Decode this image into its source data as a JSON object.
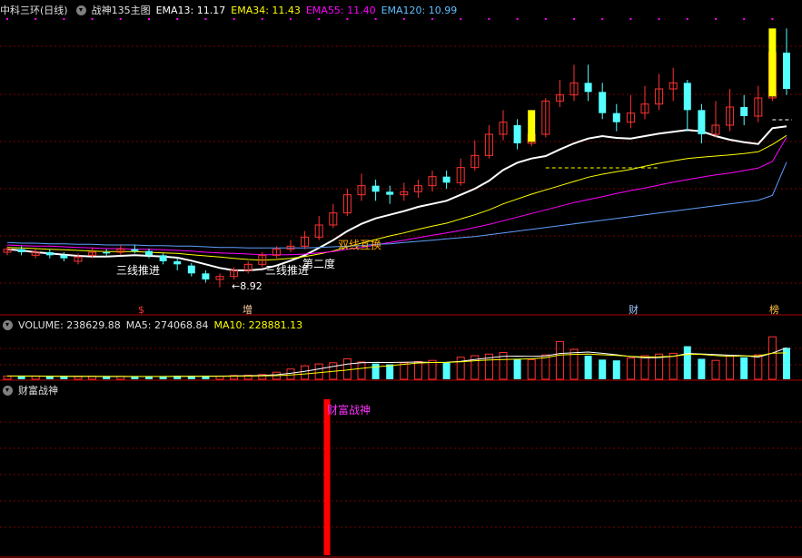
{
  "main_header": {
    "title": "中科三环(日线)",
    "indicator": "战神135主图",
    "ema13": "EMA13: 11.17",
    "ema34": "EMA34: 11.43",
    "ema55": "EMA55: 11.40",
    "ema120": "EMA120: 10.99"
  },
  "volume_header": {
    "volume": "VOLUME: 238629.88",
    "ma5": "MA5: 274068.84",
    "ma10": "MA10: 228881.13"
  },
  "sub_header": {
    "title": "财富战神"
  },
  "annotations": {
    "push1": "三线推进",
    "push2": "三线推进",
    "low_price": "8.92",
    "second_time": "第二度",
    "double_cross": "双线互换",
    "sub_label": "财富战神"
  },
  "event_markers": [
    "$",
    "增",
    "财",
    "榜"
  ],
  "colors": {
    "up": "#ff3232",
    "down": "#54ffff",
    "ema13": "#ffffff",
    "ema34": "#ffff00",
    "ema55": "#ff00ff",
    "ema120": "#5f9fff",
    "signal_bar": "#ffff00",
    "grid": "#7a0000",
    "sub_bar": "#ff0000"
  },
  "chart_data": [
    {
      "type": "candlestick",
      "title": "中科三环(日线)",
      "ylim": [
        8.6,
        13.4
      ],
      "low_marker": 8.92,
      "series": [
        {
          "name": "EMA13",
          "values": [
            9.55,
            9.53,
            9.5,
            9.48,
            9.46,
            9.44,
            9.43,
            9.43,
            9.44,
            9.45,
            9.44,
            9.43,
            9.41,
            9.36,
            9.3,
            9.24,
            9.2,
            9.2,
            9.22,
            9.28,
            9.36,
            9.45,
            9.57,
            9.7,
            9.85,
            9.97,
            10.06,
            10.12,
            10.18,
            10.25,
            10.3,
            10.35,
            10.45,
            10.55,
            10.68,
            10.86,
            10.98,
            11.05,
            11.09,
            11.2,
            11.3,
            11.38,
            11.42,
            11.39,
            11.38,
            11.42,
            11.46,
            11.49,
            11.52,
            11.5,
            11.42,
            11.36,
            11.32,
            11.29,
            11.55,
            11.58
          ]
        },
        {
          "name": "EMA34",
          "values": [
            9.58,
            9.57,
            9.56,
            9.55,
            9.54,
            9.53,
            9.52,
            9.51,
            9.51,
            9.51,
            9.5,
            9.49,
            9.48,
            9.46,
            9.44,
            9.42,
            9.4,
            9.38,
            9.37,
            9.38,
            9.4,
            9.43,
            9.47,
            9.52,
            9.59,
            9.65,
            9.71,
            9.77,
            9.82,
            9.88,
            9.93,
            9.98,
            10.05,
            10.12,
            10.2,
            10.3,
            10.38,
            10.46,
            10.53,
            10.6,
            10.67,
            10.74,
            10.79,
            10.83,
            10.87,
            10.92,
            10.97,
            11.01,
            11.05,
            11.07,
            11.09,
            11.11,
            11.13,
            11.16,
            11.28,
            11.43
          ]
        },
        {
          "name": "EMA55",
          "values": [
            9.62,
            9.61,
            9.6,
            9.6,
            9.59,
            9.58,
            9.57,
            9.56,
            9.56,
            9.55,
            9.55,
            9.54,
            9.53,
            9.52,
            9.5,
            9.49,
            9.48,
            9.47,
            9.46,
            9.46,
            9.46,
            9.47,
            9.49,
            9.51,
            9.55,
            9.58,
            9.62,
            9.66,
            9.7,
            9.74,
            9.78,
            9.82,
            9.86,
            9.91,
            9.96,
            10.02,
            10.08,
            10.14,
            10.2,
            10.26,
            10.32,
            10.37,
            10.42,
            10.47,
            10.52,
            10.56,
            10.61,
            10.66,
            10.7,
            10.74,
            10.78,
            10.81,
            10.85,
            10.89,
            11.0,
            11.4
          ]
        },
        {
          "name": "EMA120",
          "values": [
            9.66,
            9.65,
            9.65,
            9.64,
            9.64,
            9.63,
            9.63,
            9.62,
            9.62,
            9.62,
            9.61,
            9.61,
            9.6,
            9.6,
            9.59,
            9.58,
            9.58,
            9.57,
            9.57,
            9.57,
            9.57,
            9.57,
            9.58,
            9.59,
            9.6,
            9.61,
            9.63,
            9.64,
            9.66,
            9.68,
            9.7,
            9.72,
            9.74,
            9.76,
            9.79,
            9.82,
            9.85,
            9.88,
            9.91,
            9.94,
            9.97,
            10.0,
            10.03,
            10.06,
            10.09,
            10.12,
            10.15,
            10.18,
            10.21,
            10.24,
            10.27,
            10.3,
            10.33,
            10.36,
            10.44,
            10.99
          ]
        }
      ],
      "candles": [
        [
          9.5,
          9.55,
          9.6,
          9.45
        ],
        [
          9.55,
          9.5,
          9.6,
          9.45
        ],
        [
          9.45,
          9.5,
          9.55,
          9.4
        ],
        [
          9.5,
          9.45,
          9.55,
          9.4
        ],
        [
          9.45,
          9.4,
          9.5,
          9.35
        ],
        [
          9.35,
          9.42,
          9.48,
          9.3
        ],
        [
          9.45,
          9.5,
          9.58,
          9.4
        ],
        [
          9.5,
          9.48,
          9.55,
          9.43
        ],
        [
          9.5,
          9.55,
          9.62,
          9.45
        ],
        [
          9.55,
          9.52,
          9.62,
          9.48
        ],
        [
          9.52,
          9.45,
          9.56,
          9.4
        ],
        [
          9.45,
          9.35,
          9.48,
          9.3
        ],
        [
          9.35,
          9.3,
          9.4,
          9.2
        ],
        [
          9.28,
          9.15,
          9.32,
          9.1
        ],
        [
          9.15,
          9.05,
          9.2,
          9.0
        ],
        [
          9.05,
          9.1,
          9.15,
          8.92
        ],
        [
          9.1,
          9.2,
          9.25,
          9.05
        ],
        [
          9.2,
          9.3,
          9.35,
          9.15
        ],
        [
          9.3,
          9.45,
          9.5,
          9.25
        ],
        [
          9.45,
          9.55,
          9.6,
          9.4
        ],
        [
          9.55,
          9.6,
          9.7,
          9.5
        ],
        [
          9.6,
          9.75,
          9.85,
          9.55
        ],
        [
          9.75,
          9.95,
          10.1,
          9.7
        ],
        [
          9.95,
          10.15,
          10.3,
          9.9
        ],
        [
          10.15,
          10.45,
          10.55,
          10.1
        ],
        [
          10.45,
          10.6,
          10.8,
          10.35
        ],
        [
          10.6,
          10.5,
          10.7,
          10.35
        ],
        [
          10.5,
          10.45,
          10.6,
          10.3
        ],
        [
          10.45,
          10.5,
          10.65,
          10.35
        ],
        [
          10.5,
          10.6,
          10.7,
          10.4
        ],
        [
          10.6,
          10.75,
          10.85,
          10.5
        ],
        [
          10.75,
          10.65,
          10.85,
          10.55
        ],
        [
          10.65,
          10.9,
          11.05,
          10.6
        ],
        [
          10.9,
          11.1,
          11.35,
          10.85
        ],
        [
          11.1,
          11.45,
          11.6,
          11.05
        ],
        [
          11.45,
          11.65,
          11.85,
          11.35
        ],
        [
          11.6,
          11.3,
          11.7,
          11.2
        ],
        [
          11.3,
          11.45,
          11.6,
          11.25
        ],
        [
          11.45,
          12.0,
          12.05,
          11.4
        ],
        [
          12.0,
          12.1,
          12.35,
          11.9
        ],
        [
          12.1,
          12.3,
          12.6,
          12.0
        ],
        [
          12.3,
          12.15,
          12.6,
          12.0
        ],
        [
          12.15,
          11.8,
          12.3,
          11.7
        ],
        [
          11.8,
          11.65,
          11.95,
          11.5
        ],
        [
          11.65,
          11.8,
          12.1,
          11.55
        ],
        [
          11.8,
          11.95,
          12.25,
          11.7
        ],
        [
          11.95,
          12.2,
          12.45,
          11.85
        ],
        [
          12.2,
          12.3,
          12.55,
          12.0
        ],
        [
          12.3,
          11.85,
          12.35,
          11.5
        ],
        [
          11.85,
          11.45,
          11.95,
          11.3
        ],
        [
          11.45,
          11.6,
          12.0,
          11.4
        ],
        [
          11.6,
          11.9,
          12.2,
          11.5
        ],
        [
          11.9,
          11.75,
          12.1,
          11.6
        ],
        [
          11.75,
          12.05,
          12.25,
          11.65
        ],
        [
          12.05,
          12.8,
          12.95,
          12.0
        ],
        [
          12.8,
          12.2,
          13.2,
          12.1
        ]
      ]
    },
    {
      "type": "bar",
      "title": "VOLUME",
      "ylim": [
        0,
        600000
      ],
      "values": [
        40000,
        38000,
        42000,
        36000,
        35000,
        33000,
        38000,
        30000,
        36000,
        34000,
        33000,
        35000,
        45000,
        42000,
        38000,
        40000,
        48000,
        52000,
        60000,
        90000,
        130000,
        170000,
        195000,
        210000,
        260000,
        220000,
        200000,
        190000,
        210000,
        225000,
        240000,
        215000,
        280000,
        300000,
        320000,
        340000,
        260000,
        250000,
        310000,
        480000,
        380000,
        300000,
        250000,
        240000,
        270000,
        300000,
        320000,
        330000,
        420000,
        260000,
        240000,
        300000,
        280000,
        310000,
        540000,
        400000
      ],
      "series": [
        {
          "name": "MA5",
          "values": [
            42000,
            41000,
            40000,
            39000,
            38000,
            37000,
            36000,
            35000,
            35000,
            35000,
            35000,
            35000,
            37000,
            38000,
            39000,
            40000,
            43000,
            45000,
            48000,
            58000,
            76000,
            100000,
            132000,
            163000,
            193000,
            210000,
            215000,
            214000,
            216000,
            219000,
            213000,
            216000,
            229000,
            251000,
            271000,
            291000,
            294000,
            292000,
            296000,
            328000,
            338000,
            346000,
            330000,
            311000,
            288000,
            272000,
            276000,
            292000,
            328000,
            322000,
            314000,
            306000,
            300000,
            282000,
            334000,
            400000
          ]
        },
        {
          "name": "MA10",
          "values": [
            40000,
            40000,
            39500,
            39000,
            38500,
            38000,
            37500,
            37000,
            36500,
            36000,
            36000,
            35500,
            36000,
            36500,
            37000,
            37500,
            39000,
            40500,
            42500,
            46000,
            55000,
            68000,
            84000,
            101000,
            118000,
            139000,
            157000,
            173000,
            190000,
            206000,
            213000,
            215000,
            221000,
            235000,
            245000,
            252000,
            255000,
            260000,
            273000,
            309000,
            316000,
            320000,
            312000,
            303000,
            292000,
            283000,
            285000,
            293000,
            316000,
            316000,
            301000,
            291000,
            296000,
            297000,
            331000,
            336000
          ]
        }
      ]
    },
    {
      "type": "bar",
      "title": "财富战神",
      "values": [
        0,
        0,
        0,
        0,
        0,
        0,
        0,
        0,
        0,
        0,
        0,
        0,
        0,
        0,
        0,
        0,
        0,
        0,
        0,
        0,
        0,
        0,
        0,
        0,
        0,
        0,
        0,
        0,
        0,
        0,
        0,
        0,
        0,
        0,
        0,
        0,
        0,
        0,
        0,
        0,
        0,
        0,
        0,
        0,
        0,
        0,
        0,
        0,
        0,
        0,
        0,
        0,
        0,
        0,
        0,
        0
      ],
      "signal_bars": [
        1
      ]
    }
  ]
}
